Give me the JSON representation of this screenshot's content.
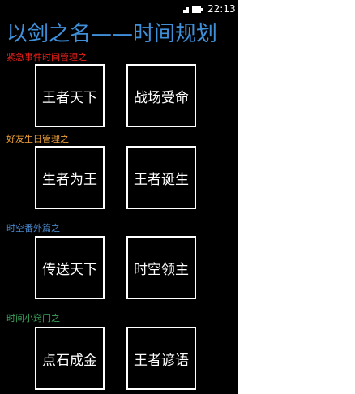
{
  "status_bar": {
    "time": "22:13",
    "icons": [
      "signal-icon",
      "battery-icon"
    ]
  },
  "app": {
    "title": "以剑之名——时间规划",
    "title_color": "#3f8fd9"
  },
  "sections": [
    {
      "label": "紧急事件时间管理之",
      "color": "#e8201a",
      "tiles": [
        "王者天下",
        "战场受命"
      ]
    },
    {
      "label": "好友生日管理之",
      "color": "#f0a13a",
      "tiles": [
        "生者为王",
        "王者诞生"
      ]
    },
    {
      "label": "时空番外篇之",
      "color": "#4a86c8",
      "tiles": [
        "传送天下",
        "时空领主"
      ]
    },
    {
      "label": "时间小窍门之",
      "color": "#3aa35a",
      "tiles": [
        "点石成金",
        "王者谚语"
      ]
    }
  ],
  "colors": {
    "background": "#000000",
    "tile_border": "#ffffff",
    "tile_text": "#ffffff"
  }
}
